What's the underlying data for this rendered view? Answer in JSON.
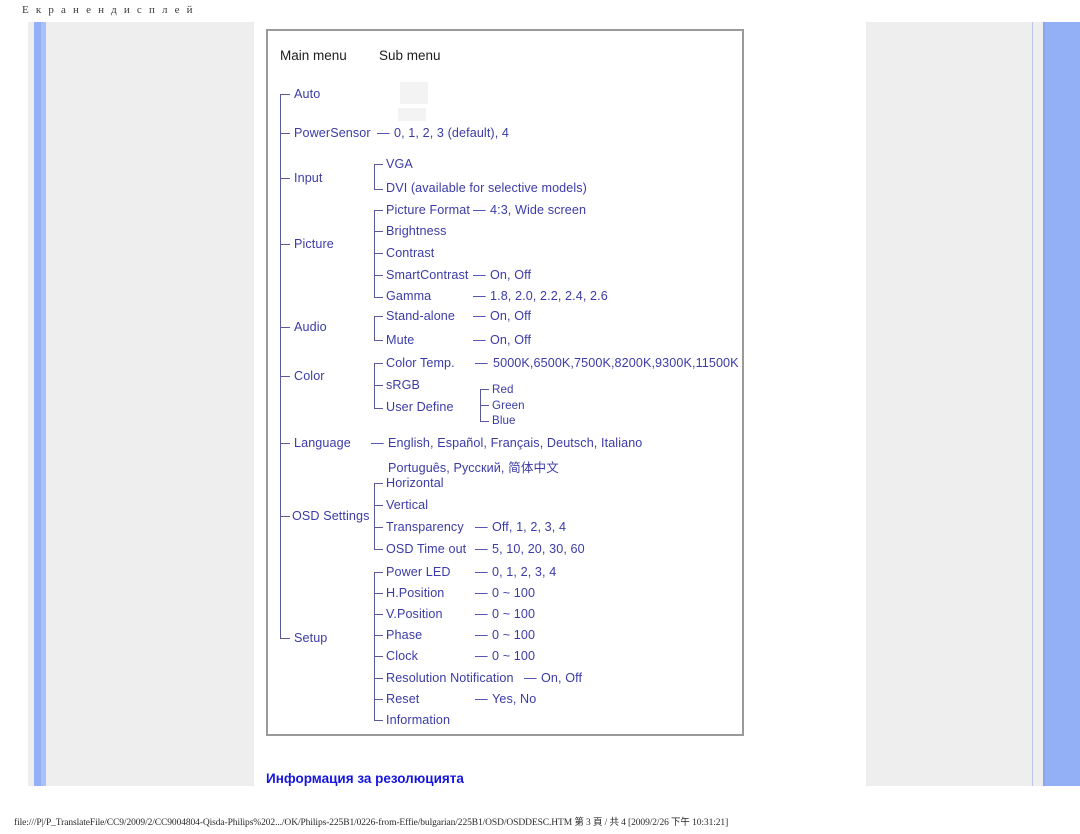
{
  "page": {
    "heading": "Е к р а н е н   д и с п л е й",
    "sub_heading": "Информация за резолюцията",
    "footer": "file:///P|/P_TranslateFile/CC9/2009/2/CC9004804-Qisda-Philips%202.../OK/Philips-225B1/0226-from-Effie/bulgarian/225B1/OSD/OSDDESC.HTM 第 3 頁 / 共 4 [2009/2/26 下午 10:31:21]"
  },
  "osd": {
    "columns": {
      "main": "Main menu",
      "sub": "Sub menu"
    },
    "items": {
      "auto": "Auto",
      "powersensor": "PowerSensor",
      "powersensor_values": "0, 1, 2, 3 (default), 4",
      "input": "Input",
      "input_vga": "VGA",
      "input_dvi": "DVI (available for selective models)",
      "picture": "Picture",
      "picture_format": "Picture Format",
      "picture_format_values": "4:3, Wide screen",
      "brightness": "Brightness",
      "contrast": "Contrast",
      "smartcontrast": "SmartContrast",
      "smartcontrast_values": "On, Off",
      "gamma": "Gamma",
      "gamma_values": "1.8, 2.0, 2.2, 2.4, 2.6",
      "audio": "Audio",
      "stand_alone": "Stand-alone",
      "stand_alone_values": "On, Off",
      "mute": "Mute",
      "mute_values": "On, Off",
      "color": "Color",
      "color_temp": "Color Temp.",
      "color_temp_values": "5000K,6500K,7500K,8200K,9300K,11500K",
      "srgb": "sRGB",
      "user_define": "User Define",
      "user_red": "Red",
      "user_green": "Green",
      "user_blue": "Blue",
      "language": "Language",
      "language_values_1": "English, Español, Français, Deutsch, Italiano",
      "language_values_2": "Português, Русский, 简体中文",
      "osd_settings": "OSD Settings",
      "horizontal": "Horizontal",
      "vertical": "Vertical",
      "transparency": "Transparency",
      "transparency_values": "Off, 1, 2, 3, 4",
      "osd_time_out": "OSD Time out",
      "osd_time_out_values": "5, 10, 20, 30, 60",
      "setup": "Setup",
      "power_led": "Power LED",
      "power_led_values": "0, 1, 2, 3, 4",
      "h_position": "H.Position",
      "h_position_values": "0 ~ 100",
      "v_position": "V.Position",
      "v_position_values": "0 ~ 100",
      "phase": "Phase",
      "phase_values": "0 ~ 100",
      "clock": "Clock",
      "clock_values": "0 ~ 100",
      "resolution_notification": "Resolution Notification",
      "resolution_notification_values": "On, Off",
      "reset": "Reset",
      "reset_values": "Yes, No",
      "information": "Information"
    },
    "dash": "—"
  }
}
